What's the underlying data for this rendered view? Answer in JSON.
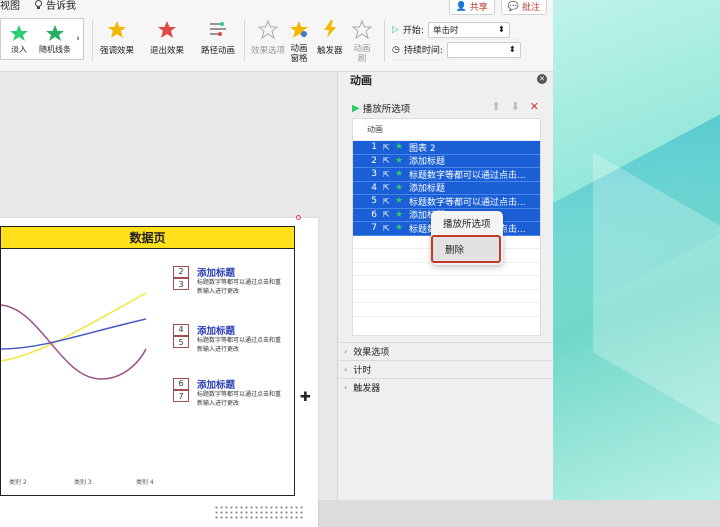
{
  "menu": {
    "view": "视图",
    "tellme": "告诉我"
  },
  "top_actions": {
    "share": "共享",
    "comment": "批注"
  },
  "gallery": [
    {
      "label": "淡入"
    },
    {
      "label": "随机线条"
    }
  ],
  "ribbon": {
    "emphasis": "强调效果",
    "exit": "退出效果",
    "path": "路径动画",
    "effect_options": "效果选项",
    "anim_pane": "动画\n窗格",
    "trigger": "触发器",
    "anim_painter": "动画\n刷"
  },
  "timing": {
    "start_label": "开始:",
    "start_value": "单击时",
    "duration_label": "持续时间:"
  },
  "slide": {
    "title": "数据页",
    "legend": [
      {
        "nums": [
          "2",
          "3"
        ],
        "title": "添加标题",
        "desc": "标题数字等都可以通过点击和重新输入进行更改"
      },
      {
        "nums": [
          "4",
          "5"
        ],
        "title": "添加标题",
        "desc": "标题数字等都可以通过点击和重新输入进行更改"
      },
      {
        "nums": [
          "6",
          "7"
        ],
        "title": "添加标题",
        "desc": "标题数字等都可以通过点击和重新输入进行更改"
      }
    ],
    "xlabels": [
      "类别 2",
      "类别 3",
      "类别 4"
    ]
  },
  "pane": {
    "title": "动画",
    "play_selected": "播放所选项",
    "list_header": "动画",
    "items": [
      {
        "n": "1",
        "text": "图表 2"
      },
      {
        "n": "2",
        "text": "添加标题"
      },
      {
        "n": "3",
        "text": "标题数字等都可以通过点击..."
      },
      {
        "n": "4",
        "text": "添加标题"
      },
      {
        "n": "5",
        "text": "标题数字等都可以通过点击..."
      },
      {
        "n": "6",
        "text": "添加标题"
      },
      {
        "n": "7",
        "text": "标题数字等都可以通过点击..."
      }
    ],
    "sections": [
      "效果选项",
      "计时",
      "触发器"
    ]
  },
  "context_menu": {
    "play_selected": "播放所选项",
    "delete": "删除"
  },
  "colors": {
    "selection": "#1a5fd6",
    "accent_red": "#c0392b",
    "title_bar": "#ffe01a"
  }
}
